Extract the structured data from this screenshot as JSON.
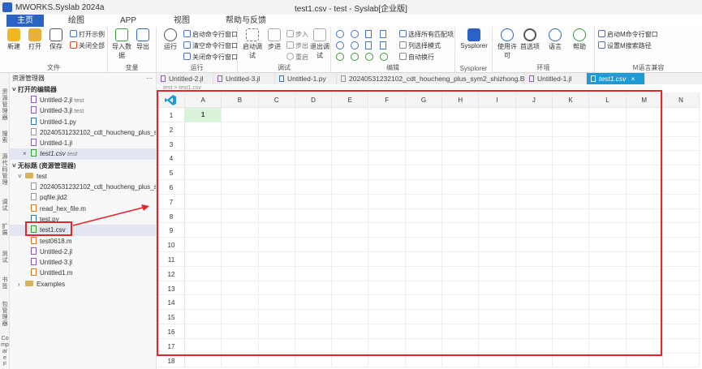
{
  "window": {
    "app_title": "MWORKS.Syslab 2024a",
    "title": "test1.csv - test - Syslab[企业版]"
  },
  "menu_tabs": [
    {
      "label": "主页",
      "active": true
    },
    {
      "label": "绘图",
      "active": false
    },
    {
      "label": "APP",
      "active": false
    },
    {
      "label": "视图",
      "active": false
    },
    {
      "label": "帮助与反馈",
      "active": false
    }
  ],
  "ribbon": {
    "file": {
      "label": "文件",
      "new": "新建",
      "open": "打开",
      "save": "保存",
      "open_example": "打开示例",
      "close_all": "关闭全部"
    },
    "variable": {
      "label": "变量",
      "import": "导入数据",
      "export": "导出"
    },
    "run": {
      "label": "运行",
      "run": "运行",
      "start_cmd": "启动命令行窗口",
      "clear_cmd": "清空命令行窗口",
      "close_cmd": "关闭命令行窗口"
    },
    "debug": {
      "label": "调试",
      "start": "启动调试",
      "step": "步进",
      "step_in": "步入",
      "step_out": "步出",
      "restart": "重启",
      "exit": "退出调试"
    },
    "edit": {
      "label": "编辑",
      "select_all_match": "选择所有匹配项",
      "column_select": "列选择模式",
      "auto_wrap": "自动换行"
    },
    "syslab": {
      "label": "Sysplorer",
      "btn": "Sysplorer"
    },
    "env": {
      "label": "环境",
      "license": "使用许可",
      "prefs": "首选项",
      "lang": "语言",
      "help": "帮助"
    },
    "m_compat": {
      "label": "M语言兼容",
      "start_m": "启动M命令行窗口",
      "set_path": "设置M搜索路径"
    }
  },
  "rail_labels": [
    "资源管理器",
    "搜索",
    "源代码管理",
    "调试",
    "扩展",
    "测试",
    "书签",
    "包管理器",
    "Compare F"
  ],
  "explorer": {
    "title": "资源管理器",
    "more": "···",
    "open_editors_label": "打开的编辑器",
    "open_editors": [
      {
        "name": "Untitled-2.jl",
        "suffix": "test",
        "type": "jl"
      },
      {
        "name": "Untitled-3.jl",
        "suffix": "test",
        "type": "jl"
      },
      {
        "name": "Untitled-1.py",
        "suffix": "",
        "type": "py"
      },
      {
        "name": "20240531232102_cdt_houcheng_plus_s...",
        "suffix": "",
        "type": "txt"
      },
      {
        "name": "Untitled-1.jl",
        "suffix": "",
        "type": "jl"
      },
      {
        "name": "test1.csv",
        "suffix": "test",
        "type": "csv",
        "close": "×"
      }
    ],
    "workspace_label": "无标题 (资源管理器)",
    "folder": "test",
    "files": [
      {
        "name": "20240531232102_cdt_houcheng_plus_s...",
        "type": "txt"
      },
      {
        "name": "pqfile.jld2",
        "type": "txt"
      },
      {
        "name": "read_hex_file.m",
        "type": "m"
      },
      {
        "name": "test.py",
        "type": "py"
      },
      {
        "name": "test1.csv",
        "type": "csv",
        "selected": true
      },
      {
        "name": "test0618.m",
        "type": "m"
      },
      {
        "name": "Untitled-2.jl",
        "type": "jl"
      },
      {
        "name": "Untitled-3.jl",
        "type": "jl"
      },
      {
        "name": "Untitled1.m",
        "type": "m"
      }
    ],
    "examples": "Examples"
  },
  "editor_tabs": [
    {
      "label": "Untitled-2.jl",
      "active": false
    },
    {
      "label": "Untitled-3.jl",
      "active": false
    },
    {
      "label": "Untitled-1.py",
      "active": false
    },
    {
      "label": "20240531232102_cdt_houcheng_plus_sym2_shizhong.BOX",
      "active": false
    },
    {
      "label": "Untitled-1.jl",
      "active": false
    },
    {
      "label": "test1.csv",
      "active": true,
      "close": "×"
    }
  ],
  "breadcrumb": "test > test1.csv",
  "sheet": {
    "columns": [
      "A",
      "B",
      "C",
      "D",
      "E",
      "F",
      "G",
      "H",
      "I",
      "J",
      "K",
      "L",
      "M",
      "N"
    ],
    "rows": [
      "1",
      "2",
      "3",
      "4",
      "5",
      "6",
      "7",
      "8",
      "9",
      "10",
      "11",
      "12",
      "13",
      "14",
      "15",
      "16",
      "17",
      "18"
    ],
    "cell_A1": "1",
    "selected_color": "#d9f2da"
  },
  "colors": {
    "accent": "#2b63c4",
    "active_tab": "#1e9bd7",
    "annotation": "#e3262a"
  }
}
